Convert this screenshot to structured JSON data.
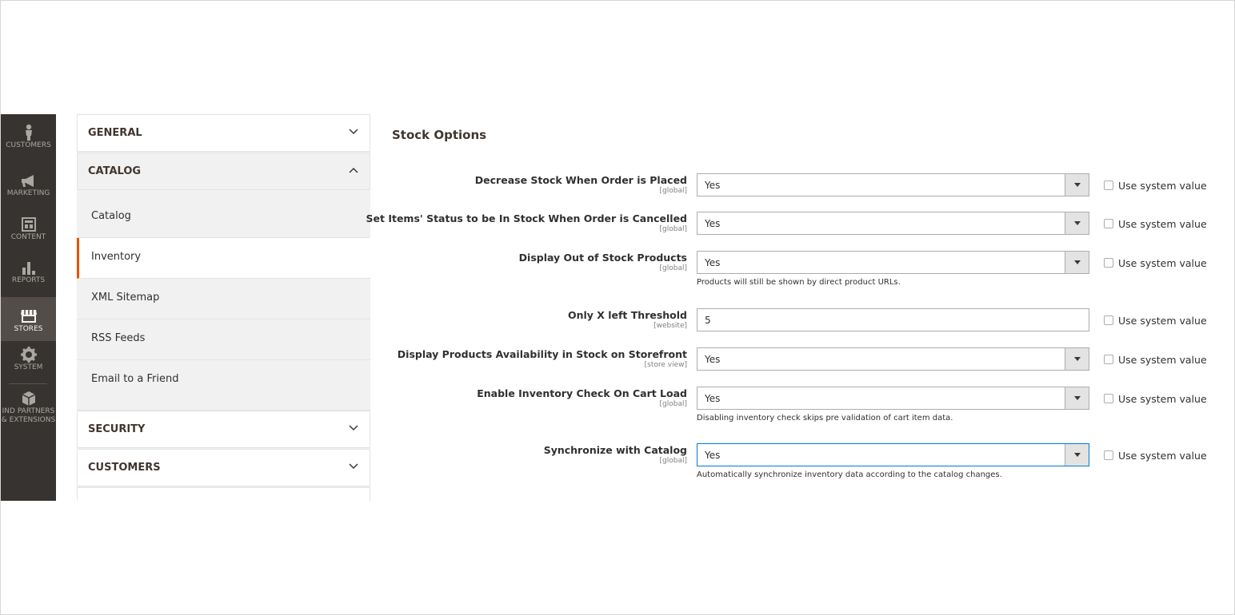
{
  "admin_menu": [
    {
      "label": "CUSTOMERS",
      "icon": "customers-icon",
      "active": false
    },
    {
      "label": "MARKETING",
      "icon": "megaphone-icon",
      "active": false
    },
    {
      "label": "CONTENT",
      "icon": "content-icon",
      "active": false
    },
    {
      "label": "REPORTS",
      "icon": "reports-icon",
      "active": false
    },
    {
      "label": "STORES",
      "icon": "stores-icon",
      "active": true
    },
    {
      "label": "SYSTEM",
      "icon": "gear-icon",
      "active": false
    },
    {
      "label_line1": "IND PARTNERS",
      "label_line2": "& EXTENSIONS",
      "icon": "extensions-icon",
      "active": false
    }
  ],
  "config_tabs": {
    "general": "GENERAL",
    "catalog": "CATALOG",
    "catalog_items": [
      "Catalog",
      "Inventory",
      "XML Sitemap",
      "RSS Feeds",
      "Email to a Friend"
    ],
    "active_item": "Inventory",
    "security": "SECURITY",
    "customers": "CUSTOMERS"
  },
  "section": {
    "title": "Stock Options"
  },
  "use_system_value_label": "Use system value",
  "fields": [
    {
      "label": "Decrease Stock When Order is Placed",
      "scope": "[global]",
      "type": "select",
      "value": "Yes",
      "note": ""
    },
    {
      "label": "Set Items' Status to be In Stock When Order is Cancelled",
      "scope": "[global]",
      "type": "select",
      "value": "Yes",
      "note": ""
    },
    {
      "label": "Display Out of Stock Products",
      "scope": "[global]",
      "type": "select",
      "value": "Yes",
      "note": "Products will still be shown by direct product URLs."
    },
    {
      "label": "Only X left Threshold",
      "scope": "[website]",
      "type": "input",
      "value": "5",
      "note": ""
    },
    {
      "label": "Display Products Availability in Stock on Storefront",
      "scope": "[store view]",
      "type": "select",
      "value": "Yes",
      "note": ""
    },
    {
      "label": "Enable Inventory Check On Cart Load",
      "scope": "[global]",
      "type": "select",
      "value": "Yes",
      "note": "Disabling inventory check skips pre validation of cart item data."
    },
    {
      "label": "Synchronize with Catalog",
      "scope": "[global]",
      "type": "select",
      "value": "Yes",
      "note": "Automatically synchronize inventory data according to the catalog changes.",
      "focused": true
    }
  ],
  "colors": {
    "admin_bar": "#373330",
    "active_accent": "#eb5202",
    "focus_border": "#007bdb"
  }
}
